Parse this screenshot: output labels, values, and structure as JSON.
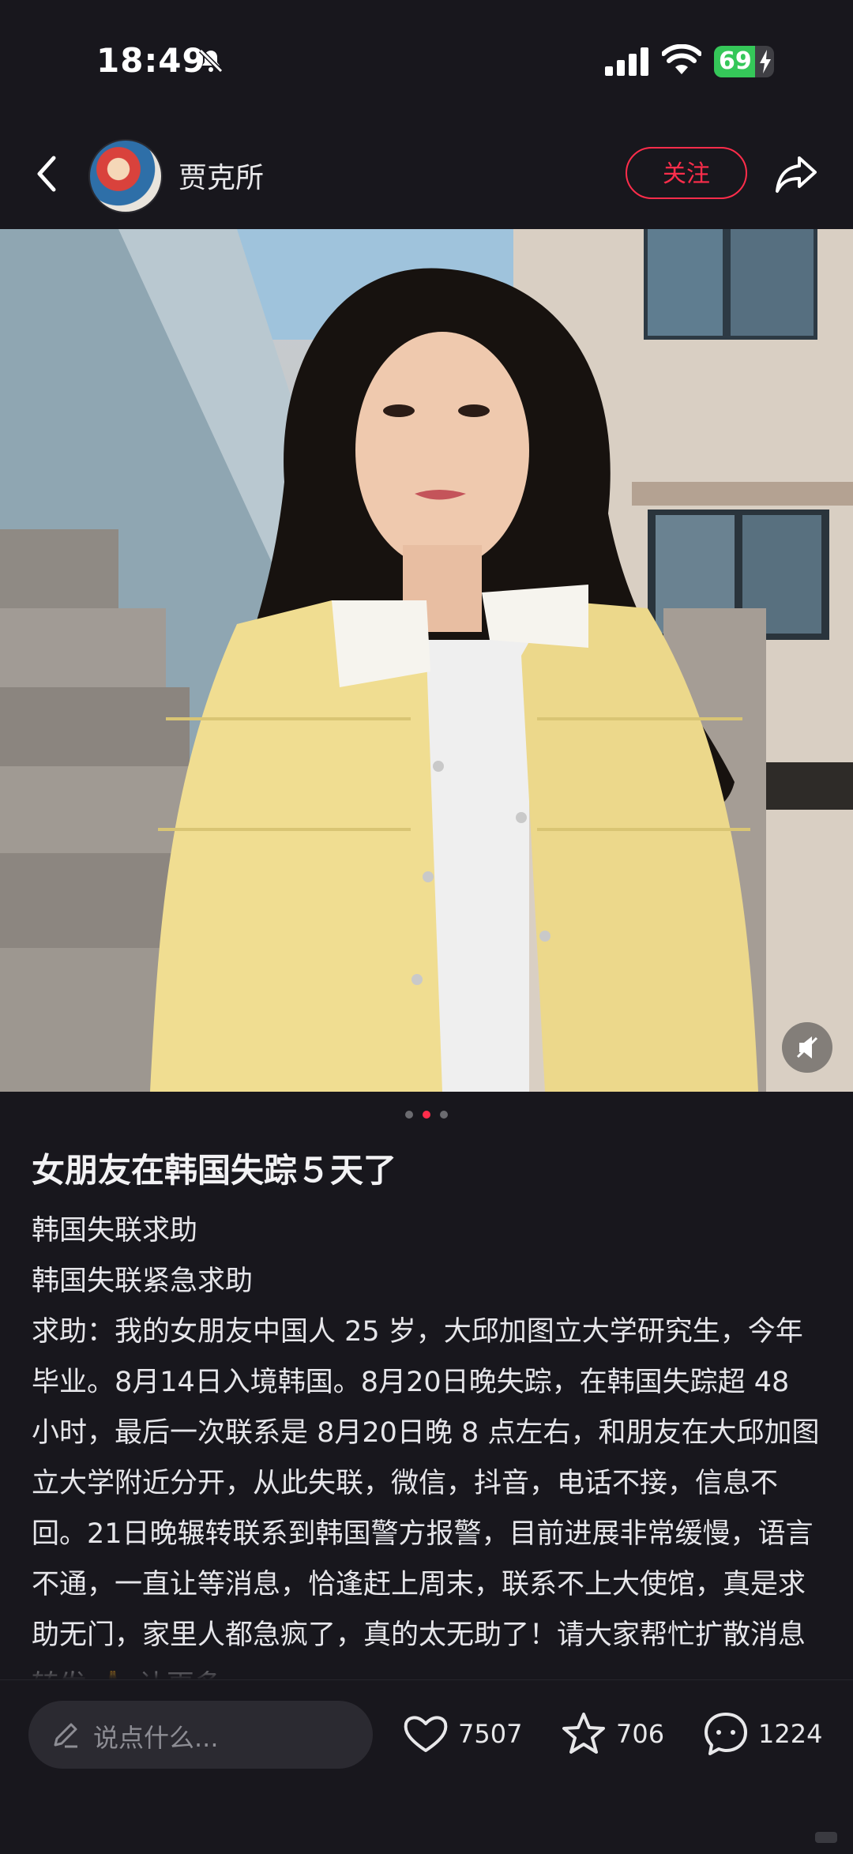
{
  "status_bar": {
    "time": "18:49",
    "battery": "69",
    "battery_level_percent": 69,
    "icons": [
      "bell-slash-icon",
      "cellular-signal-icon",
      "wifi-icon",
      "battery-charging-icon"
    ]
  },
  "nav": {
    "author_name": "贾克所",
    "follow_label": "关注",
    "icons": [
      "back-arrow-icon",
      "share-icon"
    ]
  },
  "post": {
    "image_count": 3,
    "active_image_index": 2,
    "title": "女朋友在韩国失踪５天了",
    "paragraphs": [
      "韩国失联求助",
      "韩国失联紧急求助",
      "求助：我的女朋友中国人 25 岁，大邱加图立大学研究生，今年毕业。8月14日入境韩国。8月20日晚失踪，在韩国失踪超 48 小时，最后一次联系是 8月20日晚 8 点左右，和朋友在大邱加图立大学附近分开，从此失联，微信，抖音，电话不接，信息不回。21日晚辗转联系到韩国警方报警，目前进展非常缓慢，语言不通，一直让等消息，恰逢赶上周末，联系不上大使馆，真是求助无门，家里人都急疯了，真的太无助了！请大家帮忙扩散消息转发 🙏 让更多"
    ]
  },
  "bottom_bar": {
    "comment_placeholder": "说点什么...",
    "likes": "7507",
    "favorites": "706",
    "comments": "1224"
  },
  "colors": {
    "background": "#18171d",
    "accent": "#ff2d4b",
    "battery_green": "#35c759"
  }
}
